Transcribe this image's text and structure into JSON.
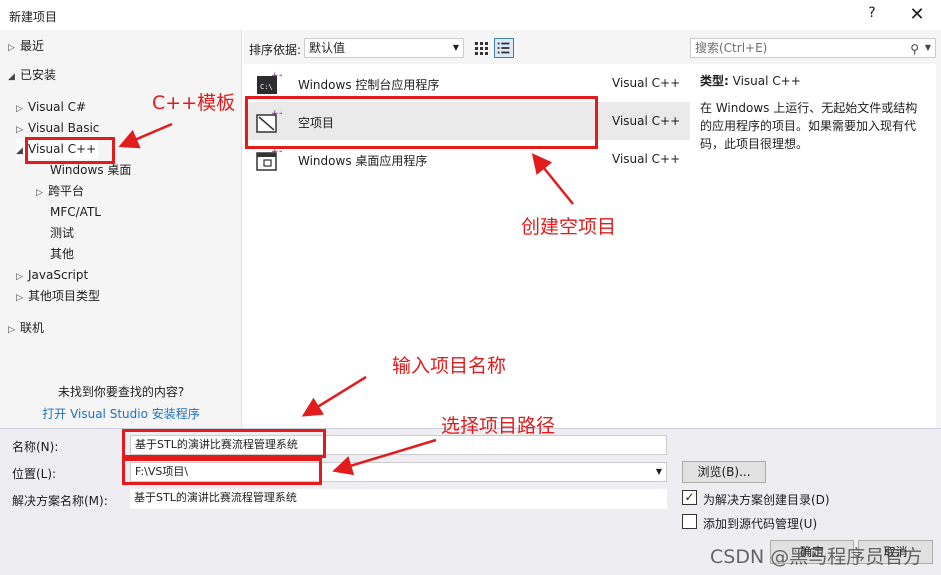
{
  "window": {
    "title": "新建项目",
    "help": "?",
    "close": "✕"
  },
  "tree": {
    "recent": "最近",
    "installed": "已安装",
    "items": [
      {
        "label": "Visual C#",
        "arrow": "▷"
      },
      {
        "label": "Visual Basic",
        "arrow": "▷"
      },
      {
        "label": "Visual C++",
        "arrow": "◢"
      },
      {
        "label": "Windows 桌面",
        "arrow": ""
      },
      {
        "label": "跨平台",
        "arrow": "▷"
      },
      {
        "label": "MFC/ATL",
        "arrow": ""
      },
      {
        "label": "测试",
        "arrow": ""
      },
      {
        "label": "其他",
        "arrow": ""
      },
      {
        "label": "JavaScript",
        "arrow": "▷"
      },
      {
        "label": "其他项目类型",
        "arrow": "▷"
      }
    ],
    "online": "联机",
    "not_found": "未找到你要查找的内容?",
    "open_installer": "打开 Visual Studio 安装程序"
  },
  "sort": {
    "label": "排序依据:",
    "value": "默认值"
  },
  "templates": [
    {
      "name": "Windows 控制台应用程序",
      "lang": "Visual C++"
    },
    {
      "name": "空项目",
      "lang": "Visual C++"
    },
    {
      "name": "Windows 桌面应用程序",
      "lang": "Visual C++"
    }
  ],
  "search": {
    "placeholder": "搜索(Ctrl+E)"
  },
  "details": {
    "type_label": "类型:",
    "type_value": "Visual C++",
    "description": "在 Windows 上运行、无起始文件或结构的应用程序的项目。如果需要加入现有代码，此项目很理想。"
  },
  "form": {
    "name_label": "名称(N):",
    "name_value": "基于STL的演讲比赛流程管理系统",
    "location_label": "位置(L):",
    "location_value": "F:\\VS项目\\",
    "solution_label": "解决方案名称(M):",
    "solution_value": "基于STL的演讲比赛流程管理系统",
    "browse": "浏览(B)...",
    "create_dir_label": "为解决方案创建目录(D)",
    "create_dir_checked": true,
    "source_control_label": "添加到源代码管理(U)",
    "ok": "确定",
    "cancel": "取消"
  },
  "annotations": {
    "cpp_template": "C++模板",
    "create_empty": "创建空项目",
    "enter_name": "输入项目名称",
    "choose_path": "选择项目路径",
    "color": "#e21c1c"
  },
  "watermark": "CSDN @黑马程序员官方"
}
